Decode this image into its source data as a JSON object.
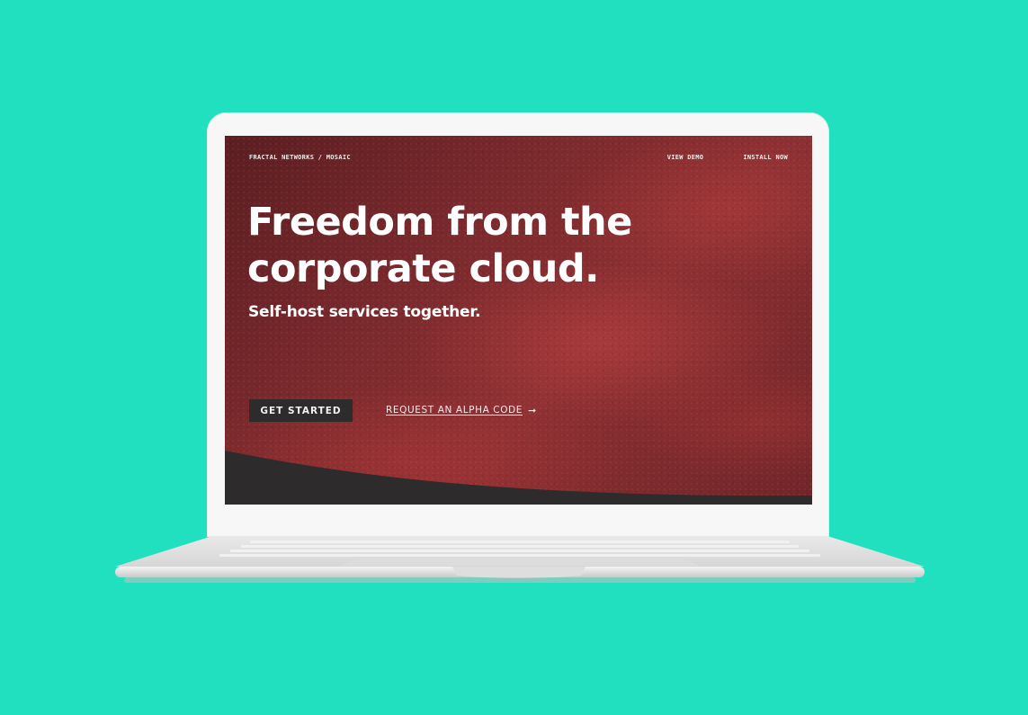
{
  "colors": {
    "background": "#21e0c0",
    "hero_red": "#7a2a2d",
    "button_dark": "#2d2b2c",
    "text_light": "#ffffff"
  },
  "nav": {
    "brand": "FRACTAL NETWORKS / MOSAIC",
    "links": [
      "VIEW DEMO",
      "INSTALL NOW"
    ]
  },
  "hero": {
    "title": "Freedom from the corporate cloud.",
    "subtitle": "Self-host services together.",
    "primary_cta": "GET STARTED",
    "secondary_cta": "REQUEST AN ALPHA CODE",
    "secondary_cta_icon": "arrow-right-icon"
  }
}
